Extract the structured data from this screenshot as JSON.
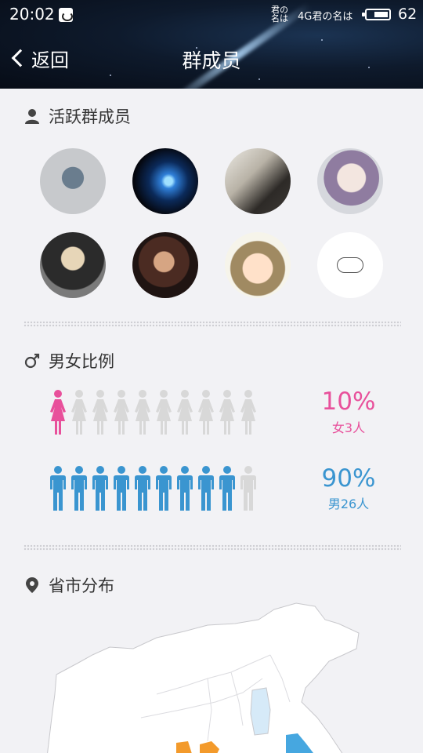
{
  "status_bar": {
    "time": "20:02",
    "carrier_1": "君の 名は",
    "network": "4G君の名は",
    "battery": "62",
    "battery_level_percent": 62
  },
  "navbar": {
    "back_label": "返回",
    "title": "群成员"
  },
  "active_members": {
    "title": "活跃群成员",
    "avatars": 8
  },
  "gender_ratio": {
    "title": "男女比例",
    "female": {
      "percent": "10%",
      "caption": "女3人",
      "filled_icons": 1,
      "total_icons": 10,
      "color": "#e8509b"
    },
    "male": {
      "percent": "90%",
      "caption": "男26人",
      "filled_icons": 9,
      "total_icons": 10,
      "color": "#3a95d0"
    },
    "empty_color": "#d8d8d8"
  },
  "region": {
    "title": "省市分布"
  }
}
